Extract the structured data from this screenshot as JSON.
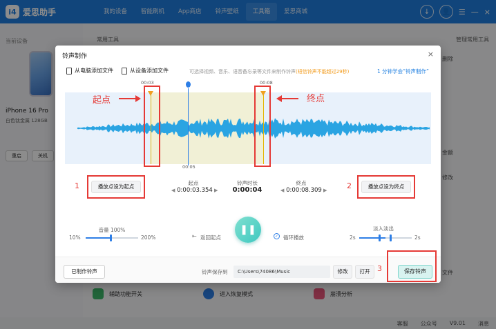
{
  "app": {
    "name": "爱思助手",
    "logo": "i4"
  },
  "nav": [
    "我的设备",
    "智能刷机",
    "App商店",
    "铃声壁纸",
    "工具箱",
    "爱思商城"
  ],
  "top_icons": {
    "download": "↓",
    "user": "👤",
    "menu": "☰",
    "minimize": "—",
    "close": "×"
  },
  "left": {
    "section": "当前设备",
    "device_name": "iPhone 16 Pro",
    "device_sub": "白色钛金属 128GB",
    "buttons": [
      "重启",
      "关机"
    ]
  },
  "bg": {
    "common_tools": "常用工具",
    "manage_tools": "管理常用工具",
    "edge_right": [
      "删除",
      "金额",
      "修改",
      "文件"
    ],
    "bottom_tools": [
      "辅助功能开关",
      "进入恢复模式",
      "崩溃分析"
    ]
  },
  "status": [
    "客服",
    "公众号",
    "V9.01",
    "消息"
  ],
  "dialog": {
    "title": "铃声制作",
    "close": "×",
    "add_from_pc": "从电脑添加文件",
    "add_from_device": "从设备添加文件",
    "hint": "可选择视频、音乐、语音备忘录等文件来制作铃声",
    "hint_warn": "(短信铃声不能超过29秒)",
    "learn": "1 分钟学会“铃声制作”",
    "time_start_top": "00:03",
    "time_end_top": "00:08",
    "time_playhead": "00:05",
    "annot_start": "起点",
    "annot_end": "终点",
    "num1": "1",
    "num2": "2",
    "num3": "3",
    "btn_set_start": "播放点设为起点",
    "btn_set_end": "播放点设为终点",
    "start_label": "起点",
    "start_val": "0:00:03.354",
    "duration_label": "铃声时长",
    "duration_val": "0:00:04",
    "end_label": "终点",
    "end_val": "0:00:08.309",
    "volume_label": "音量 100%",
    "vol_min": "10%",
    "vol_max": "200%",
    "back_start": "返回起点",
    "loop": "循环播放",
    "fade_label": "淡入淡出",
    "fade_in": "2s",
    "fade_out": "2s",
    "made_btn": "已制作铃声",
    "save_to_label": "铃声保存到",
    "save_path": "C:\\Users\\74086\\Music",
    "modify": "修改",
    "open": "打开",
    "save": "保存铃声"
  }
}
